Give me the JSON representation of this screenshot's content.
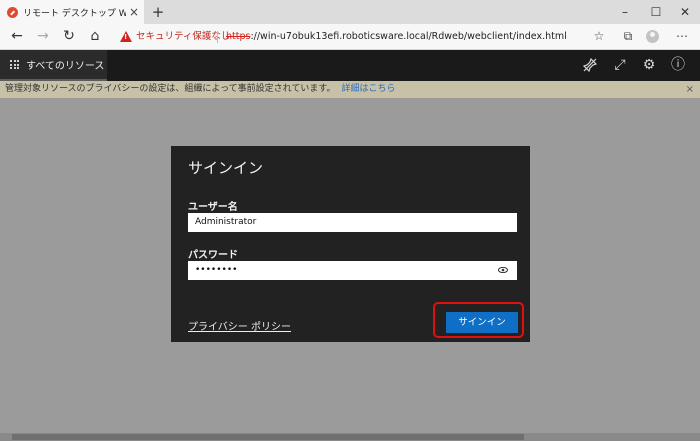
{
  "browser": {
    "tab_title": "リモート デスクトップ Web クライアント",
    "tab_close": "×",
    "new_tab": "+",
    "window_controls": [
      "–",
      "☐",
      "✕"
    ],
    "security_text": "セキュリティ保護なし",
    "url_scheme": "https",
    "url_rest": "://win-u7obuk13efi.roboticsware.local/Rdweb/webclient/index.html"
  },
  "rdweb": {
    "tab_label": "すべてのリソース"
  },
  "notice": {
    "text": "管理対象リソースのプライバシーの設定は、組織によって事前設定されています。",
    "link": "詳細はこちら",
    "close": "×"
  },
  "dialog": {
    "title": "サインイン",
    "username_label": "ユーザー名",
    "username_value": "Administrator",
    "password_label": "パスワード",
    "password_value": "••••••••",
    "privacy_link": "プライバシー ポリシー",
    "signin_button": "サインイン"
  },
  "colors": {
    "accent": "#0f6fc6",
    "highlight": "#e01010",
    "dialog_bg": "#222222"
  }
}
